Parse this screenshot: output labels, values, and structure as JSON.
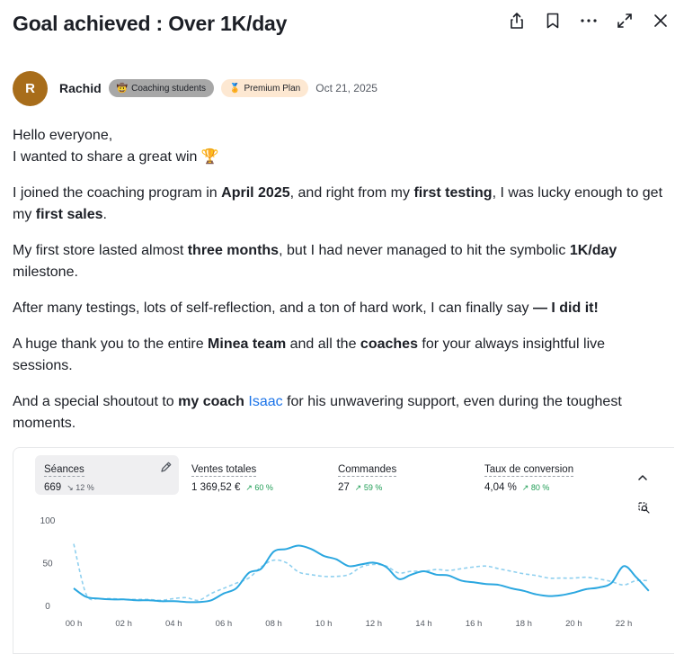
{
  "header": {
    "title": "Goal achieved : Over 1K/day",
    "actions": [
      {
        "name": "share-icon"
      },
      {
        "name": "bookmark-icon"
      },
      {
        "name": "more-icon"
      },
      {
        "name": "expand-icon"
      },
      {
        "name": "close-icon"
      }
    ]
  },
  "author": {
    "initial": "R",
    "name": "Rachid",
    "badge_coaching": "Coaching students",
    "badge_premium": "Premium Plan",
    "date": "Oct 21, 2025",
    "avatar_color": "#a86d1a"
  },
  "post": {
    "p1_line1": "Hello everyone,",
    "p1_line2": "I wanted to share a great win",
    "trophy": "🏆",
    "p2": [
      {
        "t": "I joined the coaching program in ",
        "b": false
      },
      {
        "t": "April 2025",
        "b": true
      },
      {
        "t": ", and right from my ",
        "b": false
      },
      {
        "t": "first testing",
        "b": true
      },
      {
        "t": ", I was lucky enough to get my ",
        "b": false
      },
      {
        "t": "first sales",
        "b": true
      },
      {
        "t": ".",
        "b": false
      }
    ],
    "p3": [
      {
        "t": "My first store lasted almost ",
        "b": false
      },
      {
        "t": "three months",
        "b": true
      },
      {
        "t": ", but I had never managed to hit the symbolic ",
        "b": false
      },
      {
        "t": "1K/day",
        "b": true
      },
      {
        "t": " milestone.",
        "b": false
      }
    ],
    "p4": [
      {
        "t": "After many testings, lots of self-reflection, and a ton of hard work, I can finally say ",
        "b": false
      },
      {
        "t": "— I did it!",
        "b": true
      }
    ],
    "p5": [
      {
        "t": "A huge thank you to the entire ",
        "b": false
      },
      {
        "t": "Minea team",
        "b": true
      },
      {
        "t": " and all the ",
        "b": false
      },
      {
        "t": "coaches",
        "b": true
      },
      {
        "t": " for your always insightful live sessions.",
        "b": false
      }
    ],
    "p6": [
      {
        "t": "And a special shoutout to ",
        "b": false
      },
      {
        "t": "my coach",
        "b": true
      },
      {
        "t": " ",
        "b": false
      },
      {
        "t": "Isaac",
        "link": true
      },
      {
        "t": " for his unwavering support, even during the toughest moments.",
        "b": false
      }
    ]
  },
  "dashboard": {
    "metrics": [
      {
        "label": "Séances",
        "value": "669",
        "delta": "↘ 12 %",
        "trend": "down",
        "active": true
      },
      {
        "label": "Ventes totales",
        "value": "1 369,52 €",
        "delta": "↗ 60 %",
        "trend": "up",
        "active": false
      },
      {
        "label": "Commandes",
        "value": "27",
        "delta": "↗ 59 %",
        "trend": "up",
        "active": false
      },
      {
        "label": "Taux de conversion",
        "value": "4,04 %",
        "delta": "↗ 80 %",
        "trend": "up",
        "active": false
      }
    ],
    "accent": "#2ba7e0",
    "up_color": "#1f9d55"
  },
  "chart_data": {
    "type": "line",
    "yticks": [
      "100",
      "50",
      "0"
    ],
    "ylim": [
      0,
      100
    ],
    "xticks": [
      "00 h",
      "02 h",
      "04 h",
      "06 h",
      "08 h",
      "10 h",
      "12 h",
      "14 h",
      "16 h",
      "18 h",
      "20 h",
      "22 h"
    ],
    "x": [
      0,
      0.5,
      1,
      1.5,
      2,
      2.5,
      3,
      3.5,
      4,
      4.5,
      5,
      5.5,
      6,
      6.5,
      7,
      7.5,
      8,
      8.5,
      9,
      9.5,
      10,
      10.5,
      11,
      11.5,
      12,
      12.5,
      13,
      13.5,
      14,
      14.5,
      15,
      15.5,
      16,
      16.5,
      17,
      17.5,
      18,
      18.5,
      19,
      19.5,
      20,
      20.5,
      21,
      21.5,
      22,
      22.5,
      23
    ],
    "series": [
      {
        "style": "solid",
        "values": [
          20,
          10,
          8,
          7,
          7,
          6,
          6,
          5,
          5,
          4,
          4,
          6,
          14,
          20,
          38,
          43,
          63,
          66,
          70,
          66,
          58,
          54,
          46,
          48,
          50,
          45,
          31,
          36,
          40,
          36,
          35,
          29,
          27,
          25,
          24,
          20,
          17,
          13,
          11,
          12,
          15,
          19,
          21,
          26,
          46,
          33,
          17
        ]
      },
      {
        "style": "dashed",
        "values": [
          72,
          13,
          8,
          8,
          7,
          7,
          7,
          6,
          8,
          9,
          6,
          14,
          20,
          26,
          32,
          45,
          53,
          50,
          39,
          36,
          34,
          34,
          36,
          45,
          48,
          46,
          38,
          40,
          40,
          42,
          41,
          43,
          45,
          46,
          43,
          40,
          37,
          35,
          32,
          32,
          32,
          33,
          31,
          28,
          24,
          29,
          29
        ]
      }
    ]
  }
}
